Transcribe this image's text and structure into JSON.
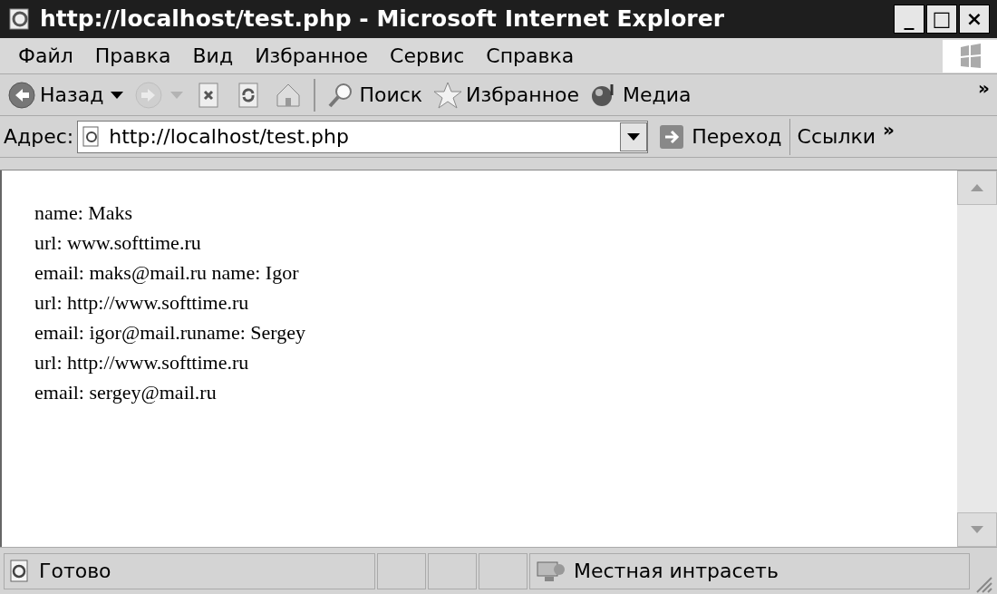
{
  "window": {
    "title": "http://localhost/test.php - Microsoft Internet Explorer",
    "controls": [
      "_",
      "□",
      "×"
    ]
  },
  "menu": [
    "Файл",
    "Правка",
    "Вид",
    "Избранное",
    "Сервис",
    "Справка"
  ],
  "toolbar": [
    {
      "kind": "back",
      "label": "Назад",
      "disabled": false
    },
    {
      "kind": "forward",
      "disabled": true
    },
    {
      "kind": "stop",
      "disabled": false
    },
    {
      "kind": "refresh",
      "disabled": false
    },
    {
      "kind": "home",
      "disabled": false
    },
    {
      "kind": "separator"
    },
    {
      "kind": "search",
      "label": "Поиск",
      "disabled": false
    },
    {
      "kind": "favorites",
      "label": "Избранное",
      "disabled": false
    },
    {
      "kind": "media",
      "label": "Медиа",
      "disabled": false
    }
  ],
  "toolbar_overflow": "»",
  "address_bar": {
    "label": "Адрес:",
    "value": "http://localhost/test.php",
    "go": "Переход",
    "links": "Ссылки",
    "links_overflow": "»"
  },
  "content": {
    "lines": [
      "name: Maks",
      "url: www.softtime.ru",
      "email: maks@mail.ru name: Igor",
      "url: http://www.softtime.ru",
      "email: igor@mail.runame: Sergey",
      "url: http://www.softtime.ru",
      "email: sergey@mail.ru"
    ]
  },
  "status_bar": {
    "text": "Готово",
    "zone": "Местная интрасеть"
  }
}
